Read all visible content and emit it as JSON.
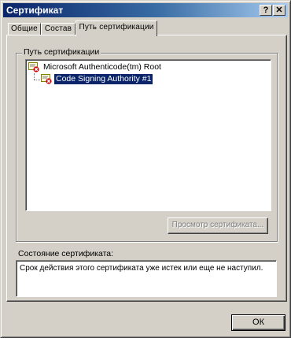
{
  "window": {
    "title": "Сертификат",
    "help_label": "?",
    "close_label": "✕"
  },
  "tabs": [
    {
      "label": "Общие",
      "active": false
    },
    {
      "label": "Состав",
      "active": false
    },
    {
      "label": "Путь сертификации",
      "active": true
    }
  ],
  "path_group": {
    "label": "Путь сертификации",
    "tree": [
      {
        "label": "Microsoft Authenticode(tm) Root",
        "icon": "certificate-error-icon",
        "selected": false
      },
      {
        "label": "Code Signing Authority #1",
        "icon": "certificate-error-icon",
        "selected": true
      }
    ],
    "view_button_label": "Просмотр сертификата..."
  },
  "status": {
    "label": "Состояние сертификата:",
    "text": "Срок действия этого сертификата уже истек или еще не наступил."
  },
  "footer": {
    "ok_label": "ОК"
  },
  "colors": {
    "title_start": "#0a246a",
    "title_end": "#a6caf0",
    "selection": "#0a246a",
    "face": "#d4d0c8"
  }
}
